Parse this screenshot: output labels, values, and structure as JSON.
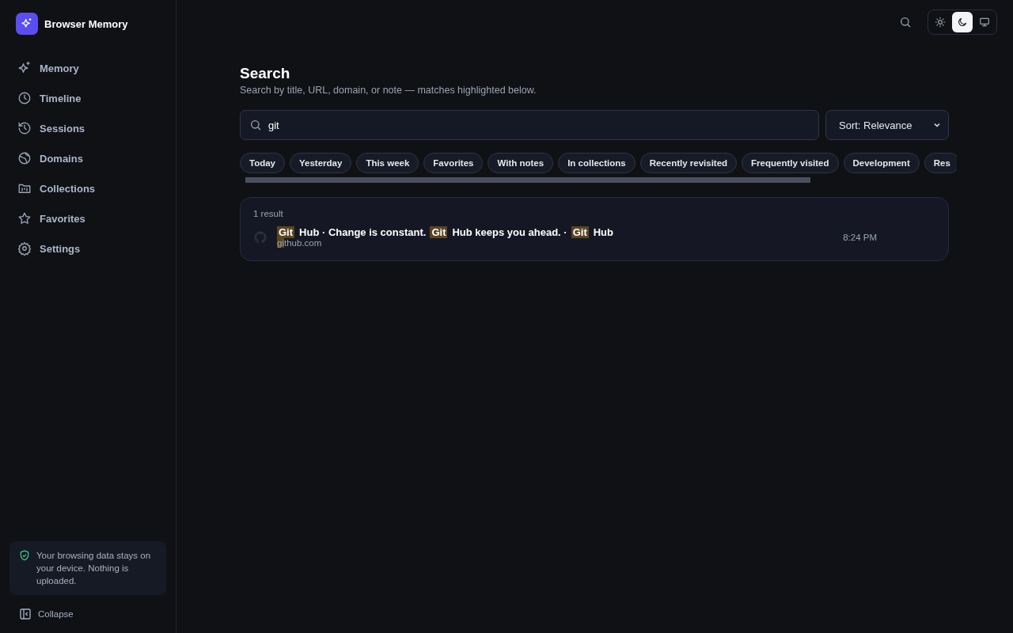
{
  "app": {
    "name": "Browser Memory"
  },
  "nav": [
    {
      "label": "Memory"
    },
    {
      "label": "Timeline"
    },
    {
      "label": "Sessions"
    },
    {
      "label": "Domains"
    },
    {
      "label": "Collections"
    },
    {
      "label": "Favorites"
    },
    {
      "label": "Settings"
    }
  ],
  "privacy_note": "Your browsing data stays on your device. Nothing is uploaded.",
  "collapse": "Collapse",
  "theme": [
    {
      "kind": "light",
      "selected": false
    },
    {
      "kind": "dark",
      "selected": true
    },
    {
      "kind": "system",
      "selected": false
    }
  ],
  "page": {
    "title": "Search",
    "subtitle": "Search by title, URL, domain, or note — matches highlighted below."
  },
  "search": {
    "value": "git"
  },
  "sort": {
    "value": "Sort: Relevance"
  },
  "chips": [
    "Today",
    "Yesterday",
    "This week",
    "Favorites",
    "With notes",
    "In collections",
    "Recently revisited",
    "Frequently visited",
    "Development",
    "Res"
  ],
  "results": {
    "count": "1 result",
    "items": [
      {
        "title": [
          {
            "text": "Git",
            "highlight": true
          },
          {
            "text": "Hub · Change is constant.",
            "highlight": false
          },
          {
            "text": "Git",
            "highlight": true
          },
          {
            "text": "Hub keeps you ahead. ·",
            "highlight": false
          },
          {
            "text": "Git",
            "highlight": true
          },
          {
            "text": "Hub",
            "highlight": false
          }
        ],
        "domain": [
          {
            "text": "gi",
            "highlight": true
          },
          {
            "text": "thub.com",
            "highlight": false
          }
        ],
        "time": "8:24 PM"
      }
    ]
  }
}
